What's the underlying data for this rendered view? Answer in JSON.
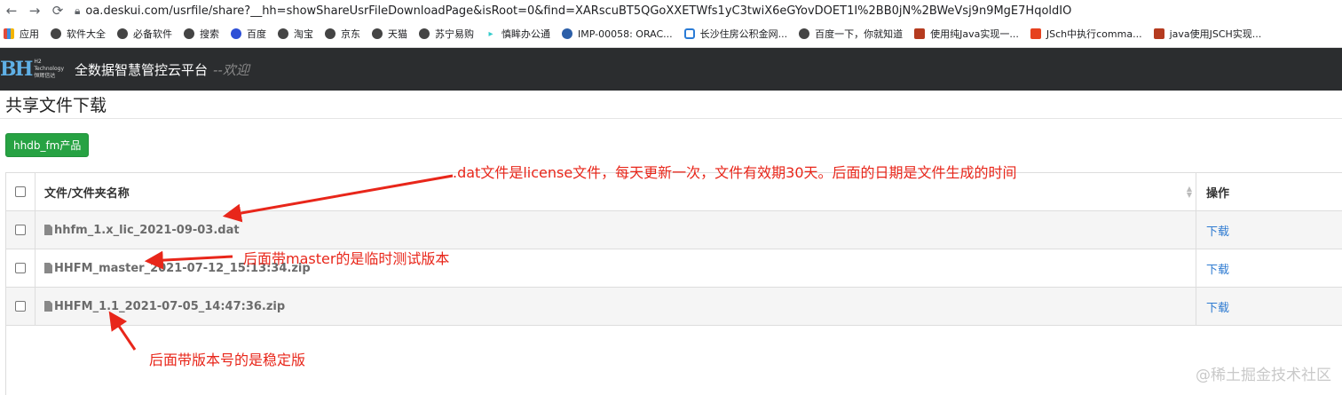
{
  "browser": {
    "url": "oa.deskui.com/usrfile/share?__hh=showShareUsrFileDownloadPage&isRoot=0&find=XARscuBT5QGoXXETWfs1yC3twiX6eGYovDOET1I%2BB0jN%2BWeVsj9n9MgE7HqoldIO",
    "bookmarks": [
      {
        "label": "应用",
        "icon": "apps-icon"
      },
      {
        "label": "软件大全",
        "icon": "globe-icon"
      },
      {
        "label": "必备软件",
        "icon": "globe-icon"
      },
      {
        "label": "搜索",
        "icon": "globe-icon"
      },
      {
        "label": "百度",
        "icon": "baidu-icon"
      },
      {
        "label": "淘宝",
        "icon": "globe-icon"
      },
      {
        "label": "京东",
        "icon": "globe-icon"
      },
      {
        "label": "天猫",
        "icon": "globe-icon"
      },
      {
        "label": "苏宁易购",
        "icon": "globe-icon"
      },
      {
        "label": "慎眸办公通",
        "icon": "arrow-icon"
      },
      {
        "label": "IMP-00058: ORAC...",
        "icon": "bookmark-icon"
      },
      {
        "label": "长沙住房公积金网...",
        "icon": "housing-icon"
      },
      {
        "label": "百度一下，你就知道",
        "icon": "globe-icon"
      },
      {
        "label": "使用纯Java实现一...",
        "icon": "blog-icon"
      },
      {
        "label": "JSch中执行comma...",
        "icon": "csdn-icon"
      },
      {
        "label": "java使用JSCH实现...",
        "icon": "blog-icon"
      }
    ]
  },
  "app": {
    "logo_text": "H2 Technology",
    "logo_sub": "恒辉信达",
    "title": "全数据智慧管控云平台",
    "welcome": "--欢迎"
  },
  "page": {
    "title": "共享文件下载",
    "product_button": "hhdb_fm产品"
  },
  "table": {
    "header_name": "文件/文件夹名称",
    "header_op": "操作",
    "rows": [
      {
        "name": "hhfm_1.x_lic_2021-09-03.dat",
        "action": "下载"
      },
      {
        "name": "HHFM_master_2021-07-12_15:13:34.zip",
        "action": "下载"
      },
      {
        "name": "HHFM_1.1_2021-07-05_14:47:36.zip",
        "action": "下载"
      }
    ]
  },
  "annotations": {
    "lic": ".dat文件是license文件，每天更新一次，文件有效期30天。后面的日期是文件生成的时间",
    "master": "后面带master的是临时测试版本",
    "stable": "后面带版本号的是稳定版"
  },
  "watermark": "@稀土掘金技术社区",
  "colors": {
    "annotation": "#e8261a",
    "green": "#27a243",
    "link": "#2f7bd1",
    "appbar": "#2b2d2f"
  }
}
